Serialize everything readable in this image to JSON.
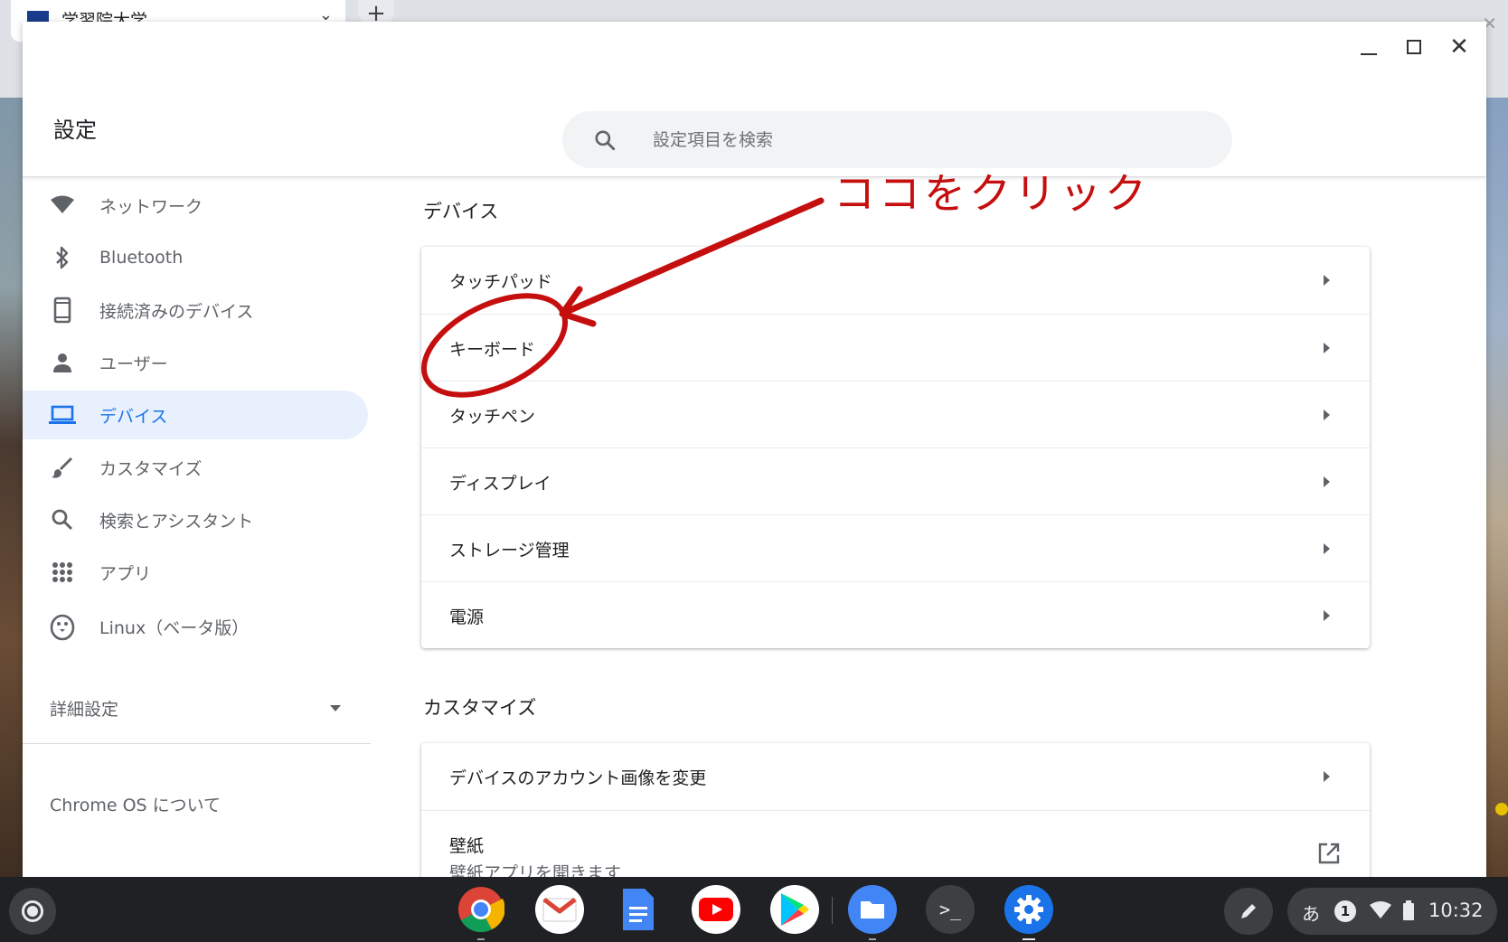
{
  "browser": {
    "tab_title": "学習院大学",
    "new_tab": "+",
    "close_glyph": "✕"
  },
  "window": {
    "title": "設定",
    "search": {
      "placeholder": "設定項目を検索",
      "value": ""
    },
    "controls": {
      "close": "✕"
    }
  },
  "sidebar": {
    "items": [
      {
        "label": "ネットワーク",
        "icon": "wifi-icon"
      },
      {
        "label": "Bluetooth",
        "icon": "bluetooth-icon"
      },
      {
        "label": "接続済みのデバイス",
        "icon": "phone-icon"
      },
      {
        "label": "ユーザー",
        "icon": "person-icon"
      },
      {
        "label": "デバイス",
        "icon": "laptop-icon",
        "active": true
      },
      {
        "label": "カスタマイズ",
        "icon": "brush-icon"
      },
      {
        "label": "検索とアシスタント",
        "icon": "search-icon"
      },
      {
        "label": "アプリ",
        "icon": "apps-grid-icon"
      },
      {
        "label": "Linux（ベータ版）",
        "icon": "penguin-icon"
      }
    ],
    "advanced": "詳細設定",
    "about": "Chrome OS について"
  },
  "main": {
    "device_section": {
      "title": "デバイス",
      "rows": [
        "タッチパッド",
        "キーボード",
        "タッチペン",
        "ディスプレイ",
        "ストレージ管理",
        "電源"
      ]
    },
    "customize_section": {
      "title": "カスタマイズ",
      "rows": [
        {
          "label": "デバイスのアカウント画像を変更"
        },
        {
          "label": "壁紙",
          "sublabel": "壁紙アプリを開きます"
        }
      ]
    }
  },
  "annotation": {
    "text": "ココをクリック",
    "color": "#c50f0f"
  },
  "shelf": {
    "apps": [
      "chrome-icon",
      "gmail-icon",
      "docs-icon",
      "youtube-icon",
      "play-store-icon",
      "files-icon",
      "terminal-icon",
      "settings-icon"
    ],
    "terminal_glyph": ">_",
    "tray": {
      "ime": "あ",
      "notifications": "1",
      "time": "10:32"
    }
  },
  "colors": {
    "accent": "#1a73e8",
    "active_bg": "#e8f0fe",
    "shelf": "#202124"
  }
}
